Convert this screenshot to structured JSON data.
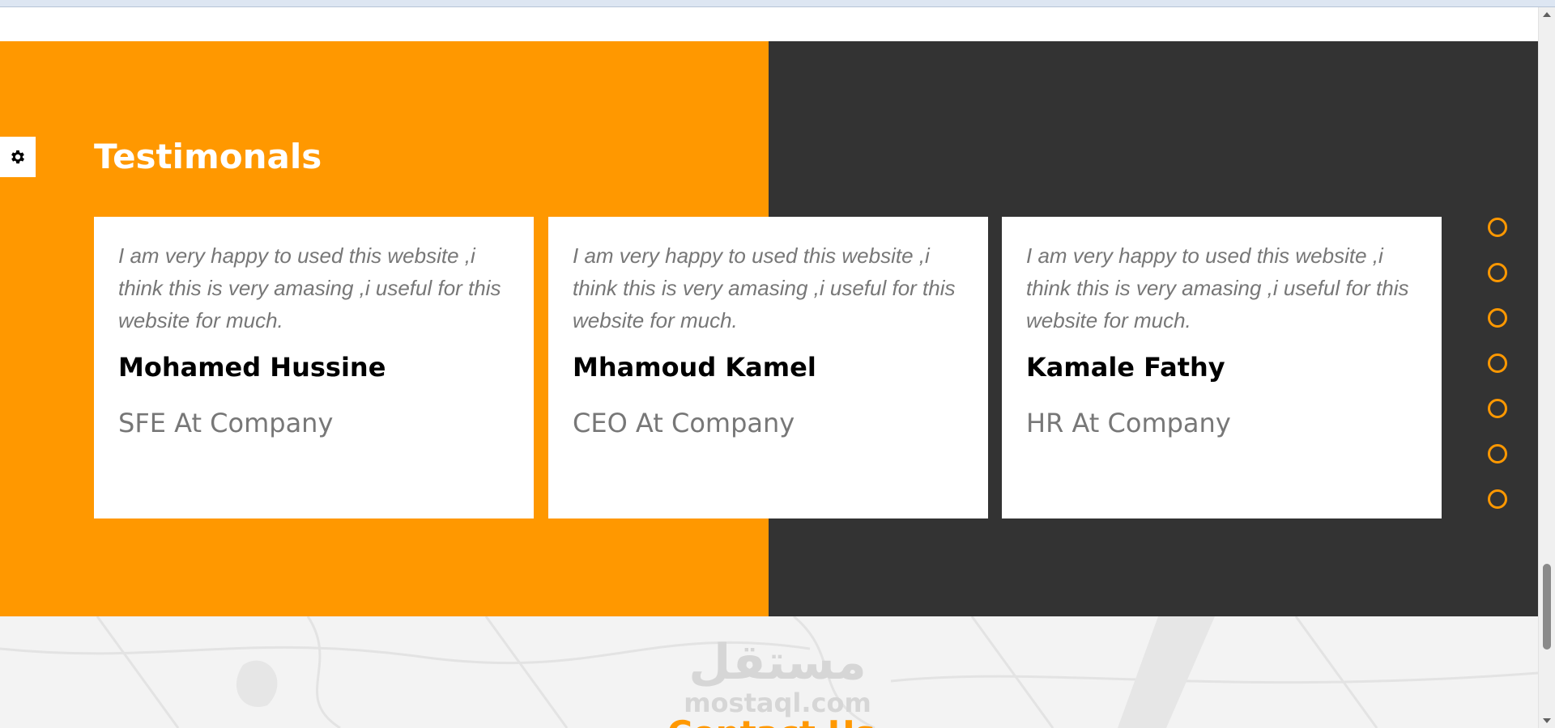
{
  "testimonials": {
    "title": "Testimonals",
    "settings_icon": "gear-icon",
    "cards": [
      {
        "quote": "I am very happy to used this website ,i think this is very amasing ,i useful for this website for much.",
        "name": "Mohamed Hussine",
        "role": "SFE At Company"
      },
      {
        "quote": "I am very happy to used this website ,i think this is very amasing ,i useful for this website for much.",
        "name": "Mhamoud Kamel",
        "role": "CEO At Company"
      },
      {
        "quote": "I am very happy to used this website ,i think this is very amasing ,i useful for this website for much.",
        "name": "Kamale Fathy",
        "role": "HR At Company"
      }
    ],
    "pagination_dot_count": 7
  },
  "watermark": {
    "arabic": "مستقل",
    "latin": "mostaql.com"
  },
  "contact": {
    "title": "Contact Us"
  },
  "colors": {
    "accent": "#ff9800",
    "dark": "#333333",
    "card_bg": "#ffffff",
    "muted_text": "#777777"
  }
}
